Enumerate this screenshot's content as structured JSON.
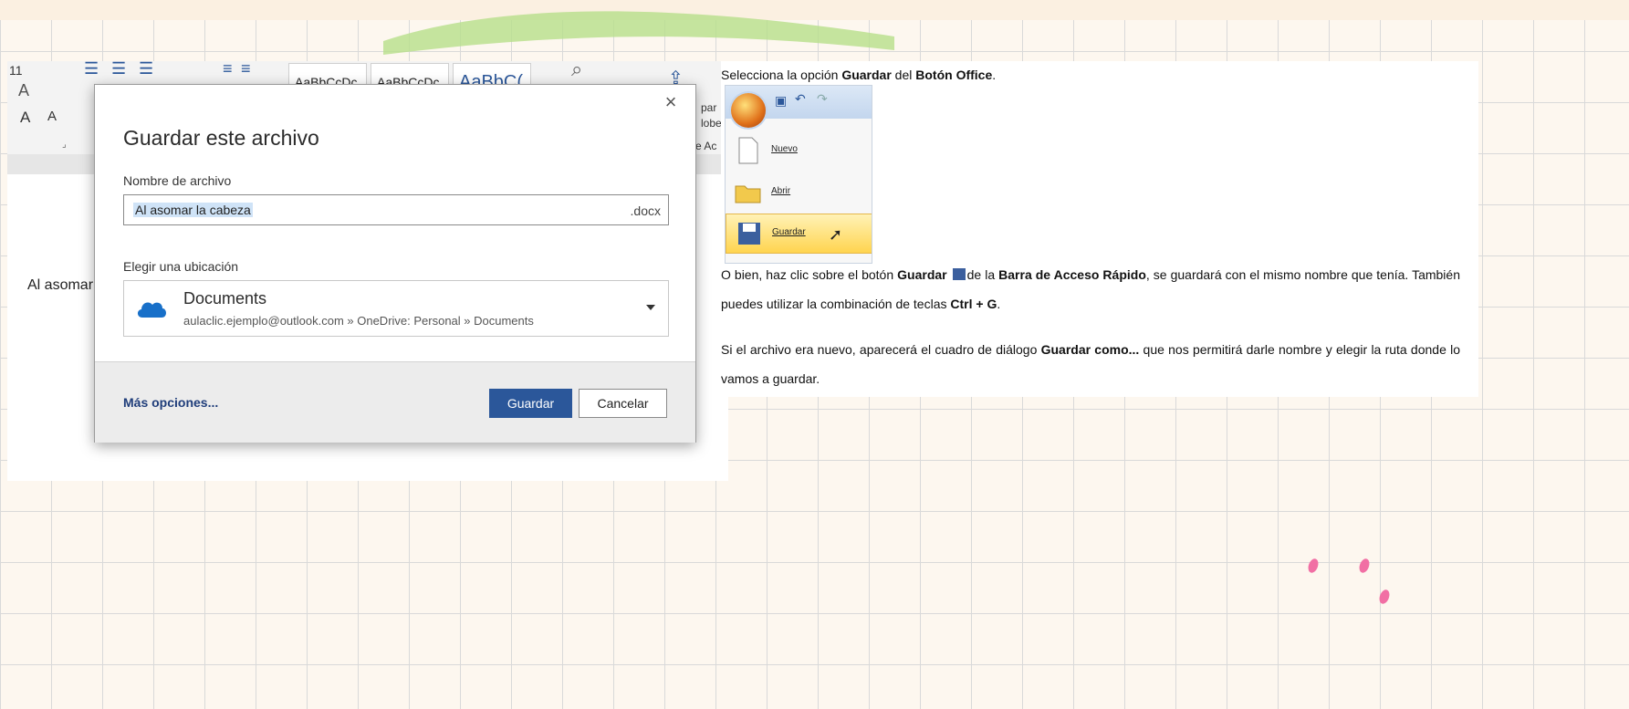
{
  "ribbon": {
    "font_size": "11",
    "styles": [
      "AaBbCcDc",
      "AaBbCcDc",
      "AaBbC("
    ],
    "partial_labels": [
      "par",
      "lobe",
      "e Ac"
    ]
  },
  "document": {
    "body_text": "Al asomar"
  },
  "dialog": {
    "close_glyph": "×",
    "title": "Guardar este archivo",
    "filename_label": "Nombre de archivo",
    "filename_value": "Al asomar la cabeza",
    "filename_ext": ".docx",
    "location_label": "Elegir una ubicación",
    "location_name": "Documents",
    "location_path": "aulaclic.ejemplo@outlook.com » OneDrive: Personal » Documents",
    "more_options": "Más opciones...",
    "save_button": "Guardar",
    "cancel_button": "Cancelar"
  },
  "tutorial": {
    "line1_pre": "Selecciona la opción ",
    "line1_b1": "Guardar",
    "line1_mid": " del ",
    "line1_b2": "Botón Office",
    "line1_end": ".",
    "office_menu": {
      "items": [
        "Nuevo",
        "Abrir",
        "Guardar"
      ],
      "highlight": "Guardar"
    },
    "p1_a": "O bien, haz clic sobre el botón ",
    "p1_b1": "Guardar",
    "p1_c": "de la ",
    "p1_b2": "Barra de Acceso Rápido",
    "p1_d": ", se guardará con el mismo nombre que tenía. También puedes utilizar la combinación de teclas ",
    "p1_b3": "Ctrl + G",
    "p1_e": ".",
    "p2_a": "Si el archivo era nuevo, aparecerá el cuadro de diálogo ",
    "p2_b": "Guardar como...",
    "p2_c": " que nos permitirá darle nombre y elegir la ruta donde lo vamos a guardar."
  },
  "colors": {
    "accent": "#2b579a",
    "highlight": "#cfe3f7",
    "link": "#1f3d7a"
  }
}
